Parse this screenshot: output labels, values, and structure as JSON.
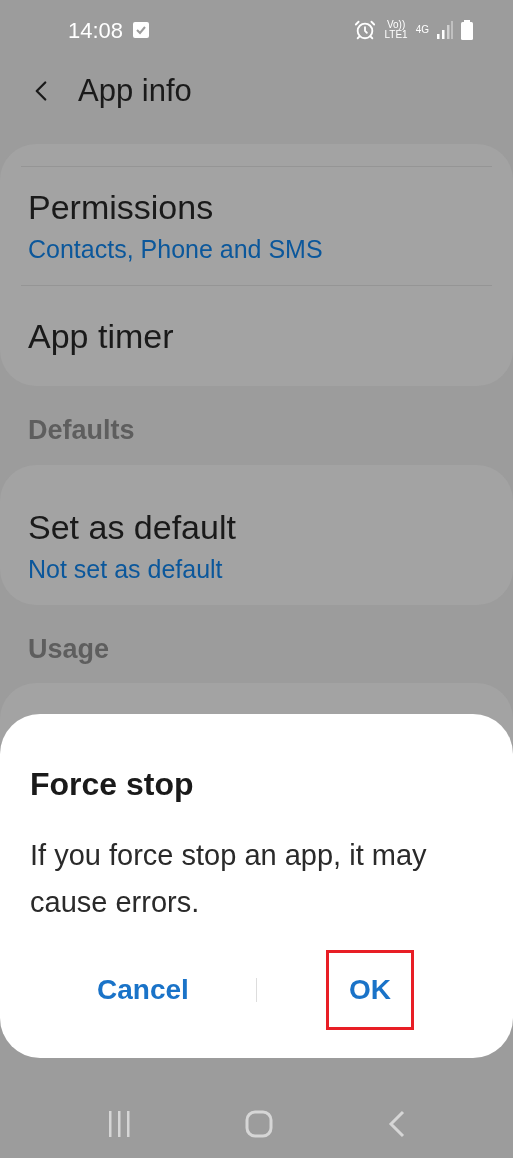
{
  "status_bar": {
    "time": "14:08",
    "volte_top": "Vo))",
    "volte_bottom": "LTE1",
    "network": "4G"
  },
  "header": {
    "title": "App info"
  },
  "sections": [
    {
      "items": [
        {
          "title": "Permissions",
          "subtitle": "Contacts, Phone and SMS"
        },
        {
          "title": "App timer"
        }
      ]
    },
    {
      "header": "Defaults",
      "items": [
        {
          "title": "Set as default",
          "subtitle": "Not set as default"
        }
      ]
    },
    {
      "header": "Usage"
    }
  ],
  "dialog": {
    "title": "Force stop",
    "message": "If you force stop an app, it may cause errors.",
    "buttons": [
      {
        "label": "Cancel",
        "highlighted": false
      },
      {
        "label": "OK",
        "highlighted": true
      }
    ]
  }
}
